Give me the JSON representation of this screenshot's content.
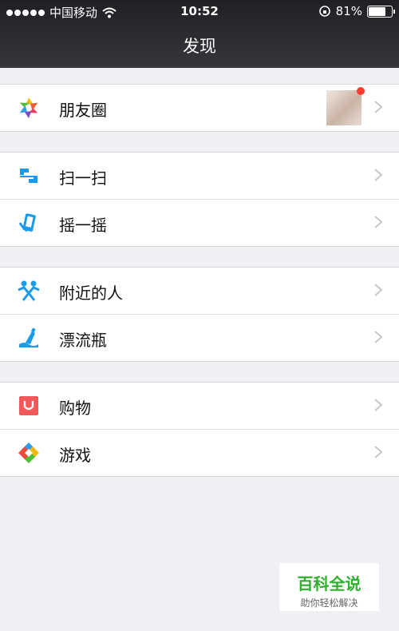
{
  "status_bar": {
    "carrier": "中国移动",
    "time": "10:52",
    "battery": "81%",
    "battery_level": 0.81
  },
  "header": {
    "title": "发现"
  },
  "groups": [
    {
      "items": [
        {
          "label": "朋友圈",
          "icon": "moments-icon"
        }
      ]
    },
    {
      "items": [
        {
          "label": "扫一扫",
          "icon": "scan-icon"
        },
        {
          "label": "摇一摇",
          "icon": "shake-icon"
        }
      ]
    },
    {
      "items": [
        {
          "label": "附近的人",
          "icon": "people-nearby-icon"
        },
        {
          "label": "漂流瓶",
          "icon": "drift-bottle-icon"
        }
      ]
    },
    {
      "items": [
        {
          "label": "购物",
          "icon": "shopping-icon"
        },
        {
          "label": "游戏",
          "icon": "games-icon"
        }
      ]
    }
  ],
  "watermark": {
    "title": "百科全说",
    "subtitle": "助你轻松解决"
  },
  "colors": {
    "accent_blue": "#1a9bea",
    "badge_red": "#ff3b30",
    "watermark_green": "#2eb02e"
  }
}
